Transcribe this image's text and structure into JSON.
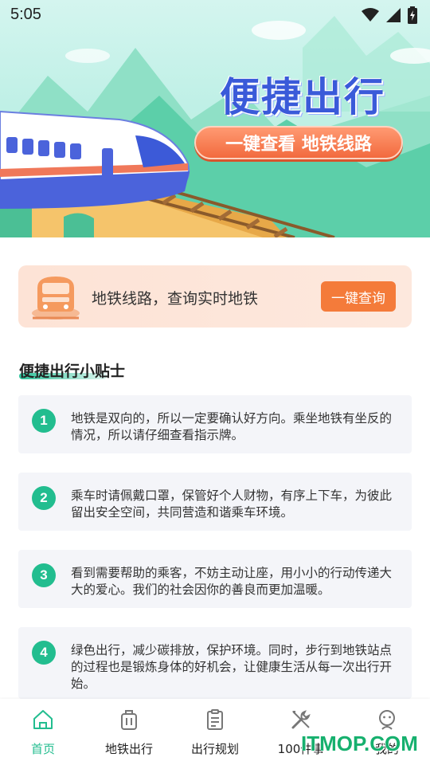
{
  "status_bar": {
    "time": "5:05",
    "icons": [
      "wifi-icon",
      "signal-icon",
      "battery-charging-icon"
    ]
  },
  "banner": {
    "title": "便捷出行",
    "pill_text": "一键查看  地铁线路"
  },
  "query_card": {
    "text": "地铁线路，查询实时地铁",
    "button_label": "一键查询",
    "icon": "train-icon"
  },
  "tips": {
    "heading": "便捷出行小贴士",
    "items": [
      {
        "number": "1",
        "text": "地铁是双向的，所以一定要确认好方向。乘坐地铁有坐反的情况，所以请仔细查看指示牌。"
      },
      {
        "number": "2",
        "text": "乘车时请佩戴口罩，保管好个人财物，有序上下车，为彼此留出安全空间，共同营造和谐乘车环境。"
      },
      {
        "number": "3",
        "text": "看到需要帮助的乘客，不妨主动让座，用小小的行动传递大大的爱心。我们的社会因你的善良而更加温暖。"
      },
      {
        "number": "4",
        "text": "绿色出行，减少碳排放，保护环境。同时，步行到地铁站点的过程也是锻炼身体的好机会，让健康生活从每一次出行开始。"
      }
    ]
  },
  "bottom_nav": {
    "items": [
      {
        "label": "首页",
        "icon": "home-icon",
        "active": true
      },
      {
        "label": "地铁出行",
        "icon": "luggage-icon",
        "active": false
      },
      {
        "label": "出行规划",
        "icon": "clipboard-icon",
        "active": false
      },
      {
        "label": "100件事",
        "icon": "tools-icon",
        "active": false
      },
      {
        "label": "我的",
        "icon": "profile-icon",
        "active": false
      }
    ]
  },
  "watermark": "ITMOP.COM",
  "colors": {
    "accent_green": "#22bd8f",
    "accent_orange": "#f47b3a",
    "banner_title_blue": "#3a5ad9"
  }
}
